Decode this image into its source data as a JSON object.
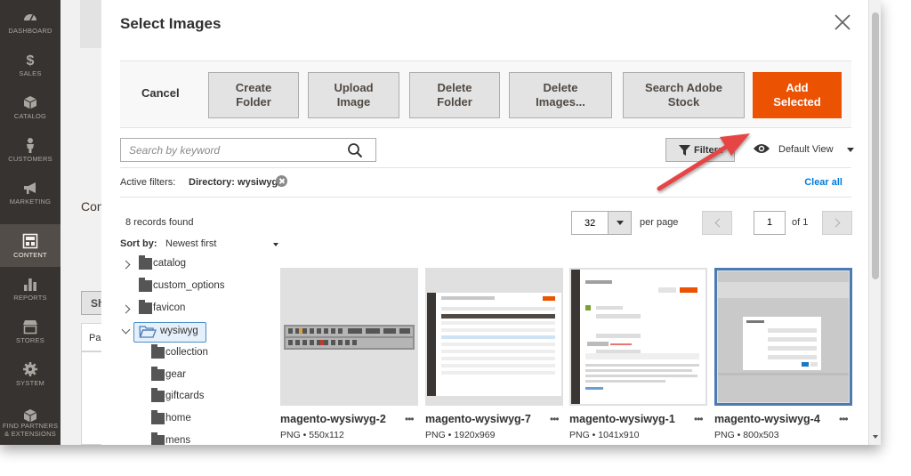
{
  "sidebar": {
    "items": [
      {
        "label": "DASHBOARD",
        "icon": "dashboard-icon"
      },
      {
        "label": "SALES",
        "icon": "dollar-icon"
      },
      {
        "label": "CATALOG",
        "icon": "cube-icon"
      },
      {
        "label": "CUSTOMERS",
        "icon": "person-icon"
      },
      {
        "label": "MARKETING",
        "icon": "megaphone-icon"
      },
      {
        "label": "CONTENT",
        "icon": "content-icon",
        "active": true
      },
      {
        "label": "REPORTS",
        "icon": "bar-chart-icon"
      },
      {
        "label": "STORES",
        "icon": "store-icon"
      },
      {
        "label": "SYSTEM",
        "icon": "gear-icon"
      },
      {
        "label": "FIND PARTNERS & EXTENSIONS",
        "icon": "box-icon"
      }
    ]
  },
  "background": {
    "section_label": "Con",
    "button_label": "Sh",
    "column_label": "Pa"
  },
  "modal": {
    "title": "Select Images",
    "toolbar": {
      "cancel_label": "Cancel",
      "create_folder_label": "Create\nFolder",
      "upload_image_label": "Upload\nImage",
      "delete_folder_label": "Delete\nFolder",
      "delete_images_label": "Delete\nImages...",
      "search_adobe_stock_label": "Search Adobe\nStock",
      "add_selected_label": "Add\nSelected"
    },
    "search": {
      "placeholder": "Search by keyword"
    },
    "filters_label": "Filters",
    "view_label": "Default View",
    "active_filters": {
      "label": "Active filters:",
      "chip": "Directory: wysiwyg",
      "clear_all": "Clear all"
    },
    "records_found": "8 records found",
    "pagination": {
      "per_page_value": "32",
      "per_page_label": "per page",
      "page": "1",
      "of": "of 1"
    },
    "sort": {
      "label": "Sort by:",
      "value": "Newest first"
    },
    "tree": [
      {
        "label": "catalog",
        "toggle": "closed"
      },
      {
        "label": "custom_options",
        "toggle": "none"
      },
      {
        "label": "favicon",
        "toggle": "closed"
      },
      {
        "label": "wysiwyg",
        "toggle": "open",
        "selected": true
      },
      {
        "label": "collection",
        "toggle": "none"
      },
      {
        "label": "gear",
        "toggle": "none"
      },
      {
        "label": "giftcards",
        "toggle": "none"
      },
      {
        "label": "home",
        "toggle": "none"
      },
      {
        "label": "mens",
        "toggle": "none"
      }
    ],
    "images": [
      {
        "name": "magento-wysiwyg-2",
        "type": "PNG",
        "size": "550x112",
        "selected": false
      },
      {
        "name": "magento-wysiwyg-7",
        "type": "PNG",
        "size": "1920x969",
        "selected": false
      },
      {
        "name": "magento-wysiwyg-1",
        "type": "PNG",
        "size": "1041x910",
        "selected": false
      },
      {
        "name": "magento-wysiwyg-4",
        "type": "PNG",
        "size": "800x503",
        "selected": true
      }
    ],
    "more_label": "•••"
  },
  "colors": {
    "accent": "#eb5202",
    "link": "#007bdb",
    "sidebar_bg": "#373330",
    "annotation_arrow": "#e64545"
  }
}
